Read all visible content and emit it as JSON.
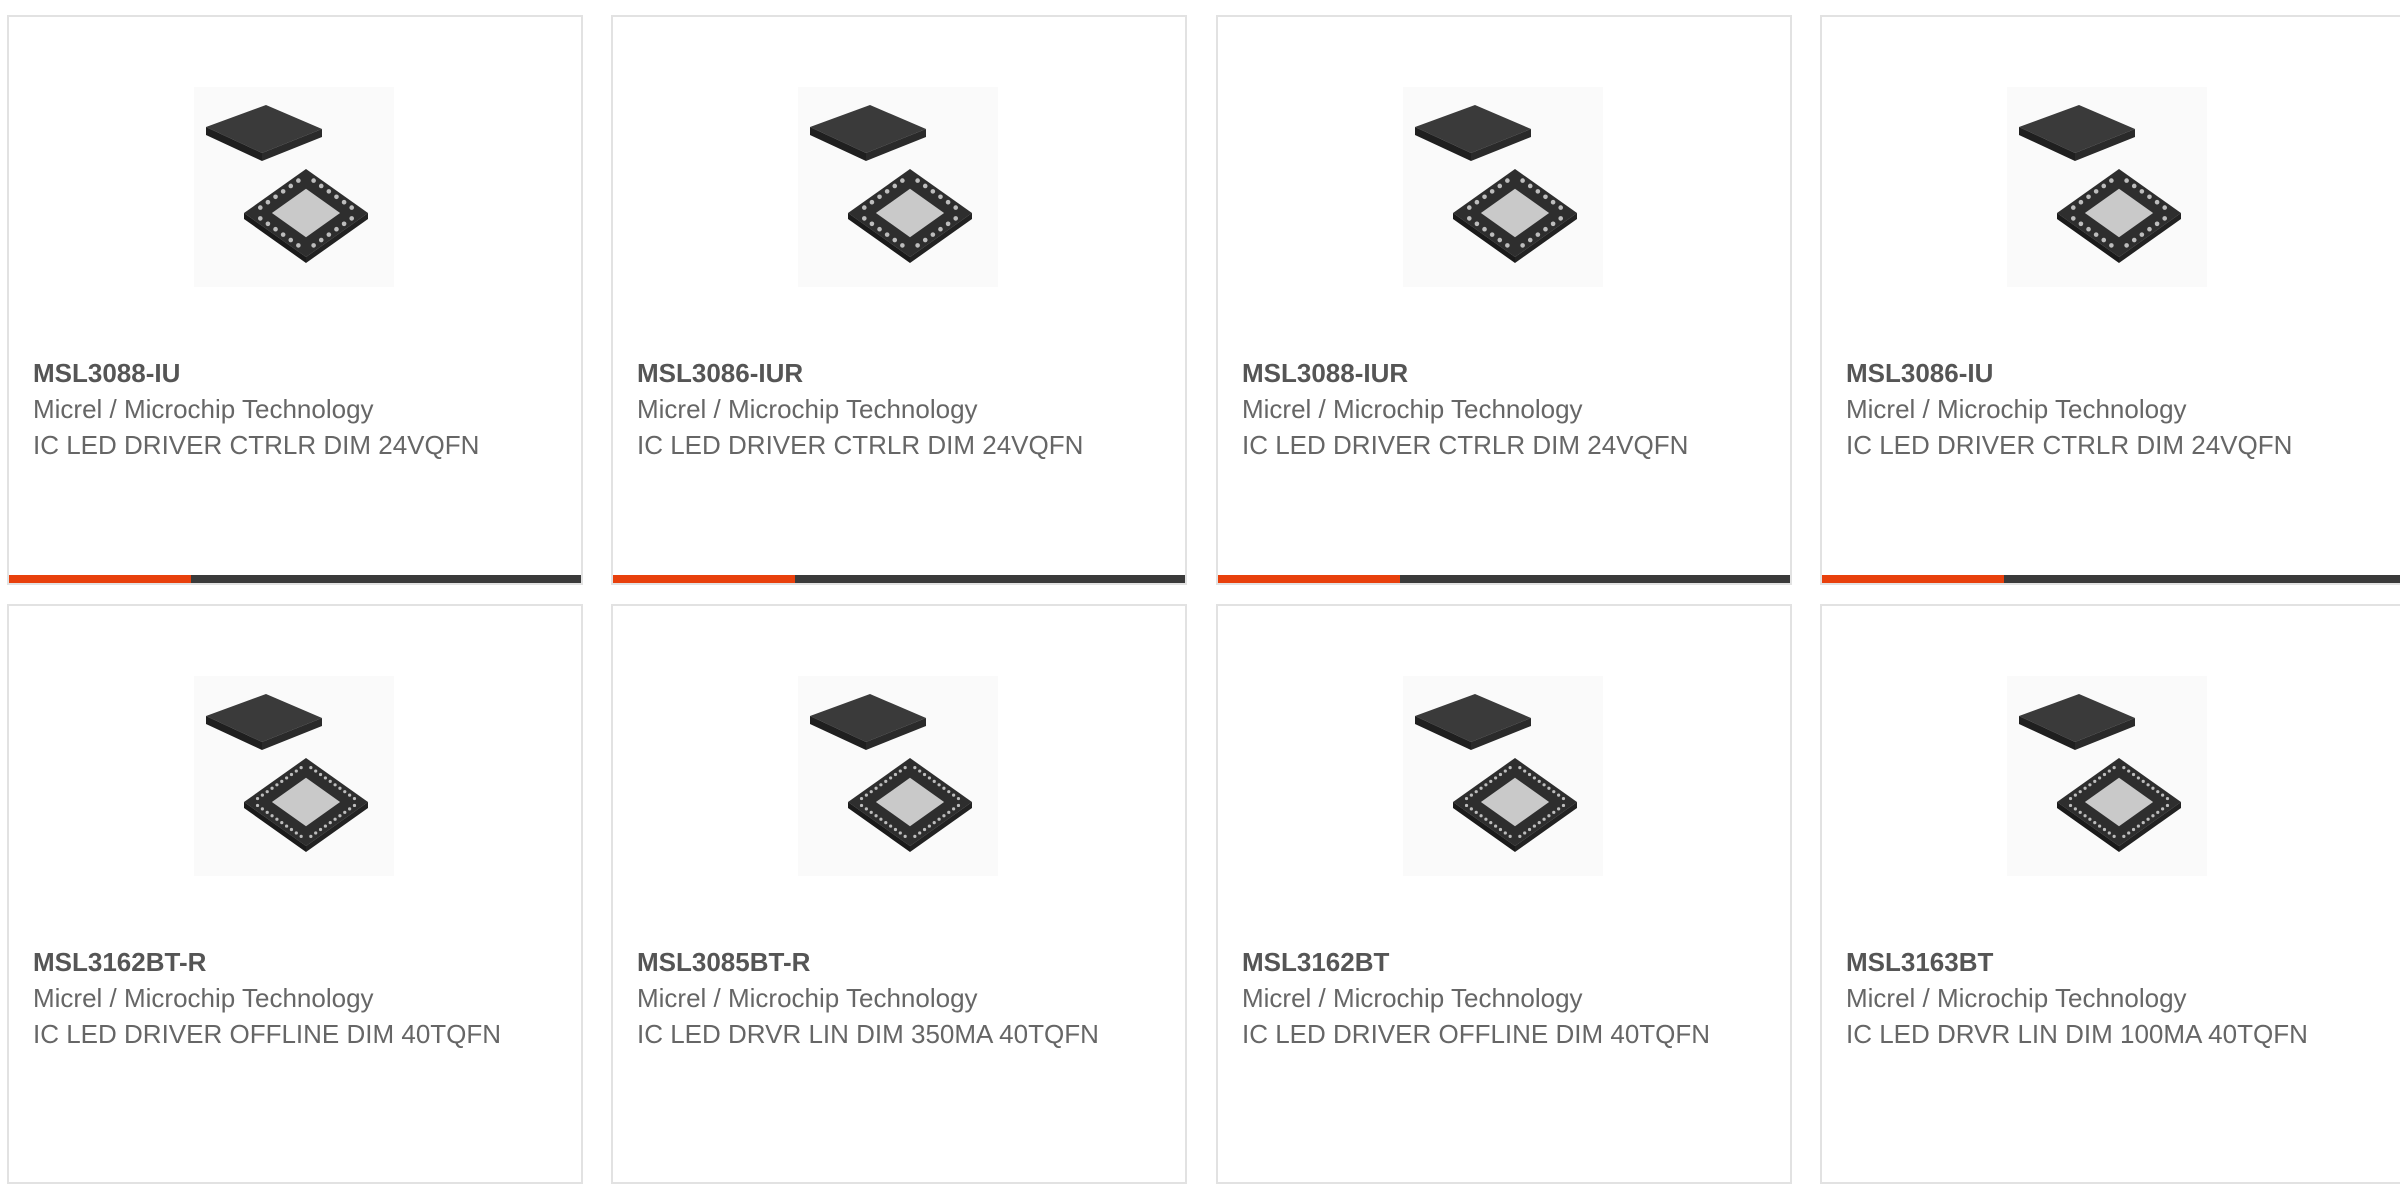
{
  "colors": {
    "accent": "#e8400c",
    "bar_dark": "#3a3a3a",
    "chip_body": "#2e2e2e",
    "chip_pad": "#c9c9c9"
  },
  "products": [
    {
      "part": "MSL3088-IU",
      "manufacturer": "Micrel / Microchip Technology",
      "description": "IC LED DRIVER CTRLR DIM 24VQFN",
      "image_icon": "qfn-chip-image",
      "package_pins": 24
    },
    {
      "part": "MSL3086-IUR",
      "manufacturer": "Micrel / Microchip Technology",
      "description": "IC LED DRIVER CTRLR DIM 24VQFN",
      "image_icon": "qfn-chip-image",
      "package_pins": 24
    },
    {
      "part": "MSL3088-IUR",
      "manufacturer": "Micrel / Microchip Technology",
      "description": "IC LED DRIVER CTRLR DIM 24VQFN",
      "image_icon": "qfn-chip-image",
      "package_pins": 24
    },
    {
      "part": "MSL3086-IU",
      "manufacturer": "Micrel / Microchip Technology",
      "description": "IC LED DRIVER CTRLR DIM 24VQFN",
      "image_icon": "qfn-chip-image",
      "package_pins": 24
    },
    {
      "part": "MSL3162BT-R",
      "manufacturer": "Micrel / Microchip Technology",
      "description": "IC LED DRIVER OFFLINE DIM 40TQFN",
      "image_icon": "tqfn-chip-image",
      "package_pins": 40
    },
    {
      "part": "MSL3085BT-R",
      "manufacturer": "Micrel / Microchip Technology",
      "description": "IC LED DRVR LIN DIM 350MA 40TQFN",
      "image_icon": "tqfn-chip-image",
      "package_pins": 40
    },
    {
      "part": "MSL3162BT",
      "manufacturer": "Micrel / Microchip Technology",
      "description": "IC LED DRIVER OFFLINE DIM 40TQFN",
      "image_icon": "tqfn-chip-image",
      "package_pins": 40
    },
    {
      "part": "MSL3163BT",
      "manufacturer": "Micrel / Microchip Technology",
      "description": "IC LED DRVR LIN DIM 100MA 40TQFN",
      "image_icon": "tqfn-chip-image",
      "package_pins": 40
    }
  ]
}
